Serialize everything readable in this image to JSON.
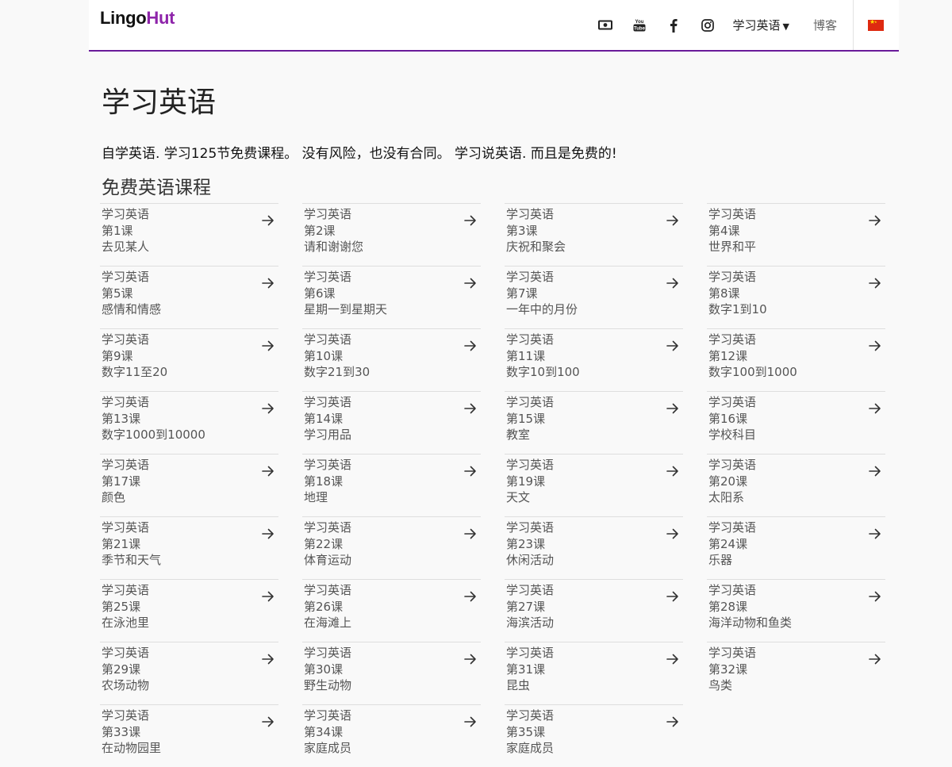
{
  "brand": {
    "part1": "Lingo",
    "part2": "Hut"
  },
  "nav": {
    "icons": [
      "money-icon",
      "youtube-icon",
      "facebook-icon",
      "instagram-icon"
    ],
    "youtube_text": "You Tube",
    "facebook_text": "f",
    "menu_label": "学习英语",
    "blog_label": "博客",
    "flag": "cn-flag-icon"
  },
  "colors": {
    "accent": "#6a1b9a",
    "logo_accent": "#8e24aa"
  },
  "main": {
    "title": "学习英语",
    "intro": "自学英语. 学习125节免费课程。 没有风险，也没有合同。 学习说英语. 而且是免费的!",
    "section_title": "免费英语课程"
  },
  "lessons": [
    {
      "line1": "学习英语",
      "line2": "第1课",
      "line3": "去见某人"
    },
    {
      "line1": "学习英语",
      "line2": "第2课",
      "line3": "请和谢谢您"
    },
    {
      "line1": "学习英语",
      "line2": "第3课",
      "line3": "庆祝和聚会"
    },
    {
      "line1": "学习英语",
      "line2": "第4课",
      "line3": "世界和平"
    },
    {
      "line1": "学习英语",
      "line2": "第5课",
      "line3": "感情和情感"
    },
    {
      "line1": "学习英语",
      "line2": "第6课",
      "line3": "星期一到星期天"
    },
    {
      "line1": "学习英语",
      "line2": "第7课",
      "line3": "一年中的月份"
    },
    {
      "line1": "学习英语",
      "line2": "第8课",
      "line3": "数字1到10"
    },
    {
      "line1": "学习英语",
      "line2": "第9课",
      "line3": "数字11至20"
    },
    {
      "line1": "学习英语",
      "line2": "第10课",
      "line3": "数字21到30"
    },
    {
      "line1": "学习英语",
      "line2": "第11课",
      "line3": "数字10到100"
    },
    {
      "line1": "学习英语",
      "line2": "第12课",
      "line3": "数字100到1000"
    },
    {
      "line1": "学习英语",
      "line2": "第13课",
      "line3": "数字1000到10000"
    },
    {
      "line1": "学习英语",
      "line2": "第14课",
      "line3": "学习用品"
    },
    {
      "line1": "学习英语",
      "line2": "第15课",
      "line3": "教室"
    },
    {
      "line1": "学习英语",
      "line2": "第16课",
      "line3": "学校科目"
    },
    {
      "line1": "学习英语",
      "line2": "第17课",
      "line3": "颜色"
    },
    {
      "line1": "学习英语",
      "line2": "第18课",
      "line3": "地理"
    },
    {
      "line1": "学习英语",
      "line2": "第19课",
      "line3": "天文"
    },
    {
      "line1": "学习英语",
      "line2": "第20课",
      "line3": "太阳系"
    },
    {
      "line1": "学习英语",
      "line2": "第21课",
      "line3": "季节和天气"
    },
    {
      "line1": "学习英语",
      "line2": "第22课",
      "line3": "体育运动"
    },
    {
      "line1": "学习英语",
      "line2": "第23课",
      "line3": "休闲活动"
    },
    {
      "line1": "学习英语",
      "line2": "第24课",
      "line3": "乐器"
    },
    {
      "line1": "学习英语",
      "line2": "第25课",
      "line3": "在泳池里"
    },
    {
      "line1": "学习英语",
      "line2": "第26课",
      "line3": "在海滩上"
    },
    {
      "line1": "学习英语",
      "line2": "第27课",
      "line3": "海滨活动"
    },
    {
      "line1": "学习英语",
      "line2": "第28课",
      "line3": "海洋动物和鱼类"
    },
    {
      "line1": "学习英语",
      "line2": "第29课",
      "line3": "农场动物"
    },
    {
      "line1": "学习英语",
      "line2": "第30课",
      "line3": "野生动物"
    },
    {
      "line1": "学习英语",
      "line2": "第31课",
      "line3": "昆虫"
    },
    {
      "line1": "学习英语",
      "line2": "第32课",
      "line3": "鸟类"
    },
    {
      "line1": "学习英语",
      "line2": "第33课",
      "line3": "在动物园里"
    },
    {
      "line1": "学习英语",
      "line2": "第34课",
      "line3": "家庭成员"
    },
    {
      "line1": "学习英语",
      "line2": "第35课",
      "line3": "家庭成员"
    }
  ]
}
